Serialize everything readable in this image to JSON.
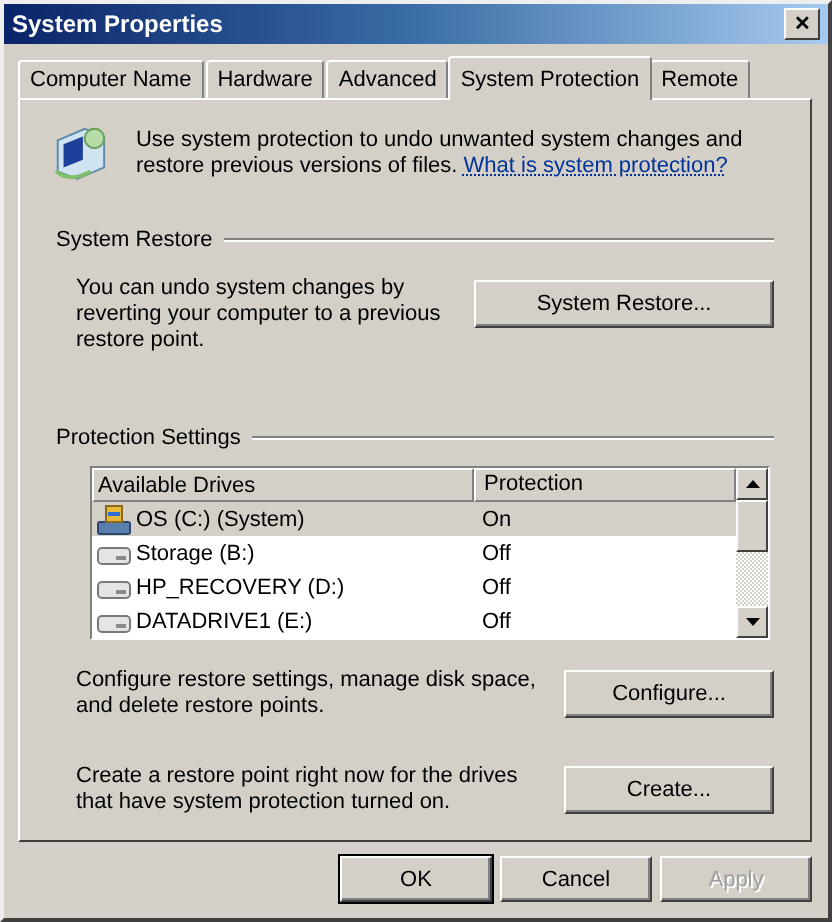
{
  "window": {
    "title": "System Properties",
    "close": "✕"
  },
  "tabs": [
    {
      "label": "Computer Name",
      "selected": false
    },
    {
      "label": "Hardware",
      "selected": false
    },
    {
      "label": "Advanced",
      "selected": false
    },
    {
      "label": "System Protection",
      "selected": true
    },
    {
      "label": "Remote",
      "selected": false
    }
  ],
  "intro": {
    "text": "Use system protection to undo unwanted system changes and restore previous versions of files.",
    "link": "What is system protection?"
  },
  "system_restore": {
    "heading": "System Restore",
    "text": "You can undo system changes by reverting your computer to a previous restore point.",
    "button": "System Restore..."
  },
  "protection_settings": {
    "heading": "Protection Settings",
    "columns": [
      "Available Drives",
      "Protection"
    ],
    "rows": [
      {
        "kind": "system",
        "name": "OS (C:) (System)",
        "protection": "On",
        "selected": true
      },
      {
        "kind": "drive",
        "name": "Storage (B:)",
        "protection": "Off",
        "selected": false
      },
      {
        "kind": "drive",
        "name": "HP_RECOVERY (D:)",
        "protection": "Off",
        "selected": false
      },
      {
        "kind": "drive",
        "name": "DATADRIVE1 (E:)",
        "protection": "Off",
        "selected": false
      }
    ],
    "configure": {
      "text": "Configure restore settings, manage disk space, and delete restore points.",
      "button": "Configure..."
    },
    "create": {
      "text": "Create a restore point right now for the drives that have system protection turned on.",
      "button": "Create..."
    }
  },
  "buttons": [
    {
      "label": "OK",
      "default": true,
      "disabled": false
    },
    {
      "label": "Cancel",
      "default": false,
      "disabled": false
    },
    {
      "label": "Apply",
      "default": false,
      "disabled": true
    }
  ]
}
